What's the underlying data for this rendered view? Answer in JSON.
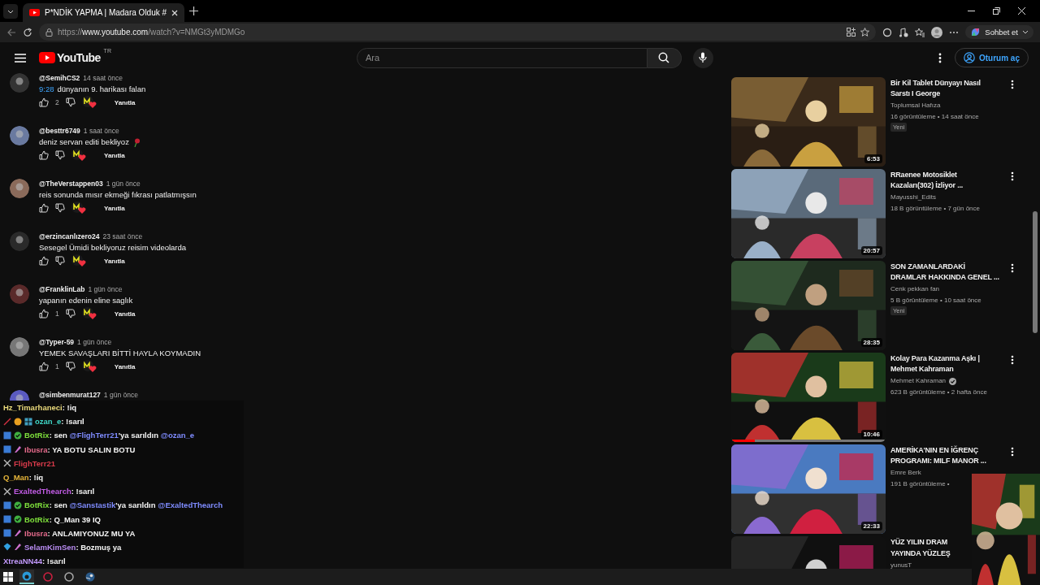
{
  "browser": {
    "tab": {
      "title": "P*NDİK YAPMA | Madara Olduk #",
      "selected": true
    },
    "url": {
      "scheme": "https://",
      "host": "www.youtube.com",
      "path": "/watch?v=NMGt3yMDMGo"
    },
    "copilot": "Sohbet et"
  },
  "youtube": {
    "logo": "YouTube",
    "country": "TR",
    "search": {
      "placeholder": "Ara"
    },
    "sign_in": "Oturum aç"
  },
  "comments": [
    {
      "author": "@SemihCS2",
      "time": "14 saat önce",
      "timestamp": "9:28",
      "text": "dünyanın 9. harikası falan",
      "likes": "2",
      "hearted": true,
      "reply": "Yanıtla"
    },
    {
      "author": "@besttr6749",
      "time": "1 saat önce",
      "text": "deniz servan editi bekliyoz",
      "rose_icon": true,
      "hearted": true,
      "reply": "Yanıtla"
    },
    {
      "author": "@TheVerstappen03",
      "time": "1 gün önce",
      "text": "reis sonunda mısır ekmeği fıkrası patlatmışsın",
      "hearted": true,
      "reply": "Yanıtla"
    },
    {
      "author": "@erzincanlızero24",
      "time": "23 saat önce",
      "text": "Sesegel Ümidi bekliyoruz reisim videolarda",
      "hearted": true,
      "reply": "Yanıtla"
    },
    {
      "author": "@FranklinLab",
      "time": "1 gün önce",
      "text": "yapanın edenin eline saglık",
      "likes": "1",
      "hearted": true,
      "reply": "Yanıtla"
    },
    {
      "author": "@Typer-59",
      "time": "1 gün önce",
      "text": "YEMEK SAVAŞLARI BİTTİ HAYLA KOYMADIN",
      "likes": "1",
      "hearted": true,
      "reply": "Yanıtla"
    },
    {
      "author": "@simbenmurat127",
      "time": "1 gün önce"
    }
  ],
  "chat": [
    {
      "user": "Hz_Timarhaneci",
      "color": "#e8d87a",
      "segments": [
        {
          "text": ": !iq",
          "kind": "text"
        }
      ]
    },
    {
      "user": "ozan_e",
      "color": "#3fd6c6",
      "badges": [
        {
          "kind": "slash"
        },
        {
          "kind": "coin"
        },
        {
          "kind": "grid"
        }
      ],
      "segments": [
        {
          "text": ": !sarıl",
          "kind": "text"
        }
      ]
    },
    {
      "user": "BotRix",
      "color": "#7fe03c",
      "badges": [
        {
          "kind": "box"
        },
        {
          "kind": "check"
        }
      ],
      "segments": [
        {
          "text": ": sen ",
          "kind": "text"
        },
        {
          "text": "@FlighTerr21",
          "kind": "mention"
        },
        {
          "text": "'ya sarıldın ",
          "kind": "text"
        },
        {
          "text": "@ozan_e",
          "kind": "mention"
        }
      ]
    },
    {
      "user": "Ibusra",
      "color": "#e56b8c",
      "badges": [
        {
          "kind": "box"
        },
        {
          "kind": "pencil"
        }
      ],
      "segments": [
        {
          "text": ": YA BOTU SALIN BOTU",
          "kind": "text"
        }
      ]
    },
    {
      "user": "FlighTerr21",
      "color": "#d83a4a",
      "badges": [
        {
          "kind": "cross"
        }
      ]
    },
    {
      "user": "Q_Man",
      "color": "#e6b53a",
      "segments": [
        {
          "text": ": !iq",
          "kind": "text"
        }
      ]
    },
    {
      "user": "ExaltedThearch",
      "color": "#c25ce6",
      "badges": [
        {
          "kind": "cross"
        }
      ],
      "segments": [
        {
          "text": ": !sarıl",
          "kind": "text"
        }
      ]
    },
    {
      "user": "BotRix",
      "color": "#7fe03c",
      "badges": [
        {
          "kind": "box"
        },
        {
          "kind": "check"
        }
      ],
      "segments": [
        {
          "text": ": sen ",
          "kind": "text"
        },
        {
          "text": "@Sanstastik",
          "kind": "mention"
        },
        {
          "text": "'ya sarıldın ",
          "kind": "text"
        },
        {
          "text": "@ExaltedThearch",
          "kind": "mention"
        }
      ]
    },
    {
      "user": "BotRix",
      "color": "#7fe03c",
      "badges": [
        {
          "kind": "box"
        },
        {
          "kind": "check"
        }
      ],
      "segments": [
        {
          "text": ": Q_Man 39 IQ",
          "kind": "text"
        }
      ]
    },
    {
      "user": "Ibusra",
      "color": "#e56b8c",
      "badges": [
        {
          "kind": "box"
        },
        {
          "kind": "pencil"
        }
      ],
      "segments": [
        {
          "text": ": ANLAMIYONUZ MU YA",
          "kind": "text"
        }
      ]
    },
    {
      "user": "SelamKimSen",
      "color": "#b98cf2",
      "badges": [
        {
          "kind": "gem"
        },
        {
          "kind": "pencil"
        }
      ],
      "segments": [
        {
          "text": ": Bozmuş ya",
          "kind": "text"
        }
      ]
    },
    {
      "user": "XtreaNN44",
      "color": "#c49bff",
      "segments": [
        {
          "text": ": !sarıl",
          "kind": "text"
        }
      ]
    }
  ],
  "videos": [
    {
      "title": "Bir Kil Tablet Dünyayı Nasıl Sarstı I George",
      "channel": "Toplumsal Hafıza",
      "stats": "16 görüntüleme • 14 saat önce",
      "badge": "Yeni",
      "duration": "6:53"
    },
    {
      "title": "RRaenee Motosiklet Kazaları(302) İzliyor ...",
      "channel": "Mayusshi_Edits",
      "stats": "18 B görüntüleme • 7 gün önce",
      "duration": "20:57"
    },
    {
      "title": "SON ZAMANLARDAKİ DRAMLAR HAKKINDA GENEL ...",
      "channel": "Cenk pekkan fan",
      "stats": "5 B görüntüleme • 10 saat önce",
      "badge": "Yeni",
      "duration": "28:35"
    },
    {
      "title": "Kolay Para Kazanma Aşkı | Mehmet Kahraman",
      "channel": "Mehmet Kahraman",
      "verified": true,
      "stats": "623 B görüntüleme • 2 hafta önce",
      "duration": "10:46",
      "level": 0.15
    },
    {
      "title": "AMERİKA'NIN EN İĞRENÇ PROGRAMI: MILF MANOR ...",
      "channel": "Emre Berk",
      "stats": "191 B görüntüleme •",
      "duration": "22:33"
    },
    {
      "title_lines": [
        "YÜZ YILIN DRAM",
        "YAYINDA YÜZLEŞ"
      ],
      "channel": "yunusT"
    }
  ]
}
